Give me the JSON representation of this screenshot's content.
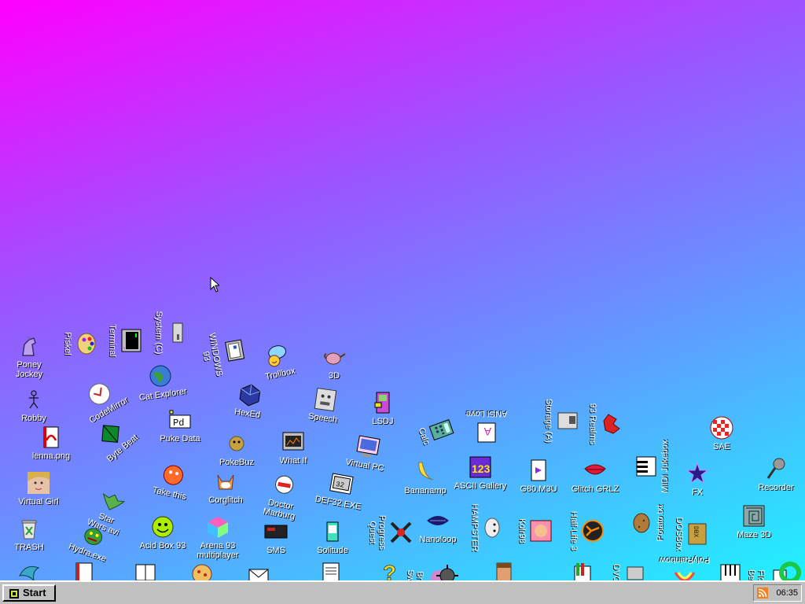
{
  "taskbar": {
    "start_label": "Start",
    "clock": "06:35"
  },
  "icons": [
    {
      "label": "Poney\nJockey",
      "icon": "pony-icon"
    },
    {
      "label": "Robby",
      "icon": "robot-icon"
    },
    {
      "label": "lenna.png",
      "icon": "image-file-icon"
    },
    {
      "label": "Virtual Girl",
      "icon": "girl-face-icon"
    },
    {
      "label": "TRASH",
      "icon": "trash-icon"
    },
    {
      "label": "Hydra.exe",
      "icon": "hydra-icon"
    },
    {
      "label": "Piskel",
      "icon": "palette-icon"
    },
    {
      "label": "Terminal",
      "icon": "terminal-icon"
    },
    {
      "label": "System (C)",
      "icon": "drive-icon"
    },
    {
      "label": "WINDOWS 93",
      "icon": "windows-icon"
    },
    {
      "label": "CodeMirror",
      "icon": "codemirror-icon"
    },
    {
      "label": "Cat Explorer",
      "icon": "globe-cat-icon"
    },
    {
      "label": "Trollbox",
      "icon": "chat-bubble-icon"
    },
    {
      "label": "3D",
      "icon": "teapot-icon"
    },
    {
      "label": "Byte Beat",
      "icon": "pyramid-icon"
    },
    {
      "label": "Puke Data",
      "icon": "pd-icon"
    },
    {
      "label": "HexEd",
      "icon": "hex-cube-icon"
    },
    {
      "label": "Speech",
      "icon": "speech-face-icon"
    },
    {
      "label": "LSDJ",
      "icon": "gameboy-icon"
    },
    {
      "label": "PokeBuz",
      "icon": "pokebuz-icon"
    },
    {
      "label": "What If",
      "icon": "whatif-icon"
    },
    {
      "label": "Virtual PC",
      "icon": "virtual-pc-icon"
    },
    {
      "label": "Calc",
      "icon": "calculator-icon"
    },
    {
      "label": "ANSI Love",
      "icon": "ansi-icon"
    },
    {
      "label": "Storage (A)",
      "icon": "storage-icon"
    },
    {
      "label": "93 Realms",
      "icon": "dragon-icon"
    },
    {
      "label": "SAE",
      "icon": "amiga-ball-icon"
    },
    {
      "label": "Take this",
      "icon": "take-this-icon"
    },
    {
      "label": "Corglitch",
      "icon": "corgi-icon"
    },
    {
      "label": "Doctor\nMarburg",
      "icon": "doctor-icon"
    },
    {
      "label": "DEF32.EXE",
      "icon": "def32-icon"
    },
    {
      "label": "Bananamp",
      "icon": "banana-icon"
    },
    {
      "label": "ASCII Gallery",
      "icon": "ascii-gallery-icon"
    },
    {
      "label": "G80.M3U",
      "icon": "playlist-icon"
    },
    {
      "label": "Glitch GRLZ",
      "icon": "lips-icon"
    },
    {
      "label": "MIDI Jukebox",
      "icon": "midi-icon"
    },
    {
      "label": "FX",
      "icon": "fx-icon"
    },
    {
      "label": "Recorder",
      "icon": "microphone-icon"
    },
    {
      "label": "Star\nWars avi",
      "icon": "yoda-icon"
    },
    {
      "label": "Acid Box 93",
      "icon": "smiley-icon"
    },
    {
      "label": "Arena 93\nmultiplayer",
      "icon": "arena-cube-icon"
    },
    {
      "label": "SMS",
      "icon": "sms-icon"
    },
    {
      "label": "Solitude",
      "icon": "solitude-icon"
    },
    {
      "label": "Progress\nQuest",
      "icon": "progress-quest-icon"
    },
    {
      "label": "Nanoloop",
      "icon": "nanoloop-icon"
    },
    {
      "label": "HAMPSTER",
      "icon": "hamster-icon"
    },
    {
      "label": "Kolr98",
      "icon": "kolr-icon"
    },
    {
      "label": "Half-Life 3",
      "icon": "half-life-icon"
    },
    {
      "label": "Potato.txt",
      "icon": "potato-icon"
    },
    {
      "label": "DOSBox",
      "icon": "dosbox-icon"
    },
    {
      "label": "Maze 3D",
      "icon": "maze-icon"
    },
    {
      "label": "Bre\nSwe",
      "icon": "sweet-icon"
    },
    {
      "label": "DVO",
      "icon": "dvo-icon"
    },
    {
      "label": "PolyRainbow",
      "icon": "rainbow-icon"
    },
    {
      "label": "Floor\nBeep",
      "icon": "floor-beep-icon"
    },
    {
      "label": "",
      "icon": "dolphin-icon"
    },
    {
      "label": "",
      "icon": "book-icon"
    },
    {
      "label": "",
      "icon": "pizza-icon"
    },
    {
      "label": "",
      "icon": "envelope-icon"
    },
    {
      "label": "",
      "icon": "notepad-icon"
    },
    {
      "label": "",
      "icon": "help-icon"
    },
    {
      "label": "",
      "icon": "virus-icon"
    },
    {
      "label": "",
      "icon": "doom-guy-icon"
    },
    {
      "label": "",
      "icon": "paint-icon"
    },
    {
      "label": "",
      "icon": "keyboard-icon"
    },
    {
      "label": "",
      "icon": "ring-icon"
    }
  ]
}
